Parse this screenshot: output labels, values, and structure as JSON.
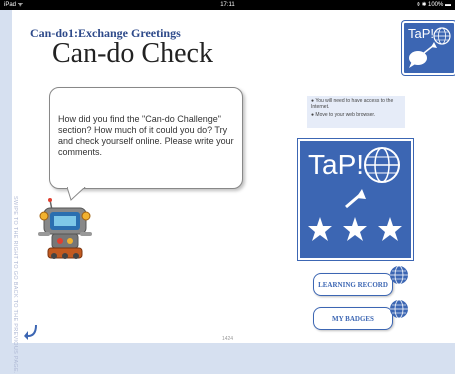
{
  "status_bar": {
    "carrier": "iPad ᯤ",
    "time": "17:11",
    "battery": "⌽ ✱ 100% ▬"
  },
  "header": {
    "subtitle": "Can-do1:Exchange Greetings",
    "title": "Can-do Check"
  },
  "logo_small": {
    "text": "TaP!"
  },
  "speech": {
    "text": "How did you find the \"Can-do Challenge\" section? How much of it could you do? Try and check yourself online. Please write your comments."
  },
  "side_hint": {
    "text": "SWIPE TO THE RIGHT TO GO BACK TO THE PREVIOUS PAGE."
  },
  "notes": [
    "● You will need to have access to the Internet.",
    "● Move to your web browser."
  ],
  "logo_big": {
    "text": "TaP!"
  },
  "buttons": {
    "learning_record": "LEARNING RECORD",
    "my_badges": "MY BADGES"
  },
  "page_number": "1424",
  "colors": {
    "brand_blue": "#3c66b3",
    "page_bg": "#d6e0f0"
  }
}
